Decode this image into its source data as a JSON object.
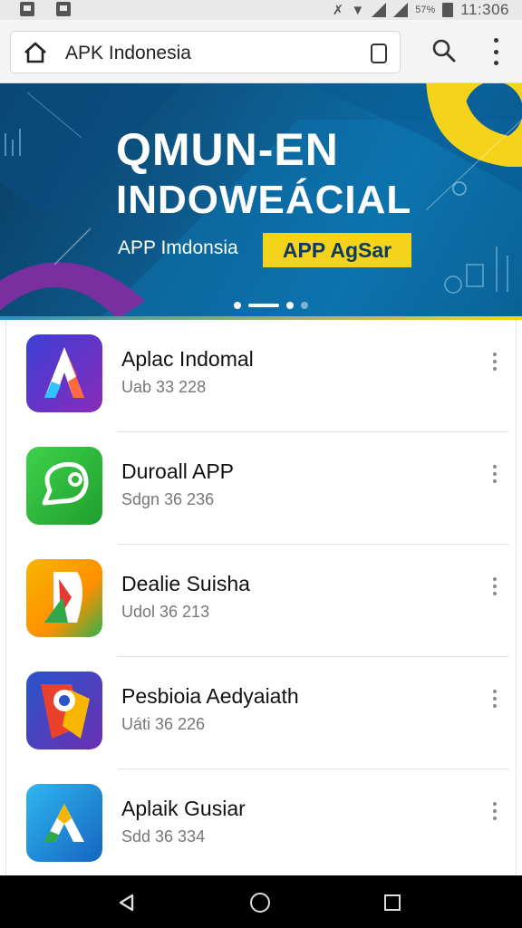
{
  "status_bar": {
    "battery_text": "57%",
    "time": "11:306"
  },
  "browser": {
    "url": "APK Indonesia"
  },
  "banner": {
    "title_line1": "QMUN-EN",
    "title_line2": "INDOWEÁCIAL",
    "subtitle": "APP Imdonsia",
    "cta_label": "APP AgSar",
    "page_indicator": {
      "current": 2,
      "total": 4
    }
  },
  "apps": [
    {
      "name": "Aplac Indomal",
      "meta": "Uab 33 228",
      "icon": "letter-a-icon"
    },
    {
      "name": "Duroall APP",
      "meta": "Sdgn 36 236",
      "icon": "chat-bubble-icon"
    },
    {
      "name": "Dealie Suisha",
      "meta": "Udol 36 213",
      "icon": "play-arrow-icon"
    },
    {
      "name": "Pesbioia Aedyaiath",
      "meta": "Uáti 36 226",
      "icon": "map-pin-icon"
    },
    {
      "name": "Aplaik Gusiar",
      "meta": "Sdd 36 334",
      "icon": "triangle-a-icon"
    }
  ],
  "colors": {
    "banner_accent_yellow": "#f5d31a",
    "banner_blue": "#0b6fa8",
    "banner_purple": "#7a2fa0"
  }
}
